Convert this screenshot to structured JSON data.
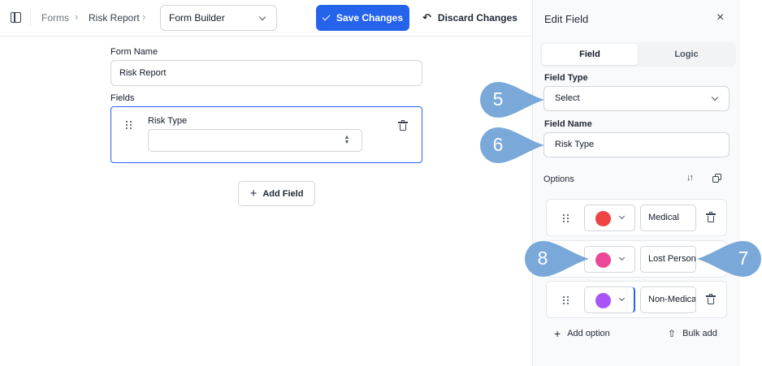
{
  "breadcrumb": {
    "root": "Forms",
    "current": "Risk Report",
    "builder_select": "Form Builder"
  },
  "toolbar": {
    "save_label": "Save Changes",
    "discard_label": "Discard Changes"
  },
  "form": {
    "name_label": "Form Name",
    "name_value": "Risk Report",
    "fields_label": "Fields",
    "field_label": "Risk Type",
    "field_value": "",
    "add_field_label": "Add Field"
  },
  "panel": {
    "title": "Edit Field",
    "close_glyph": "×",
    "tabs": [
      {
        "label": "Field",
        "active": true
      },
      {
        "label": "Logic",
        "active": false
      }
    ],
    "field_type_label": "Field Type",
    "field_type_value": "Select",
    "field_name_label": "Field Name",
    "field_name_value": "Risk Type",
    "options_label": "Options",
    "options": [
      {
        "color": "#ef4444",
        "name": "Medical"
      },
      {
        "color": "#ec4899",
        "name": "Lost Person"
      },
      {
        "color": "#a855f7",
        "name": "Non-Medical"
      }
    ],
    "add_option_label": "Add option",
    "bulk_add_label": "Bulk add"
  },
  "callouts": [
    {
      "label": "5"
    },
    {
      "label": "6"
    },
    {
      "label": "8"
    },
    {
      "label": "7"
    }
  ],
  "colors": {
    "primary": "#2563eb",
    "callout": "#7aa9d9"
  }
}
